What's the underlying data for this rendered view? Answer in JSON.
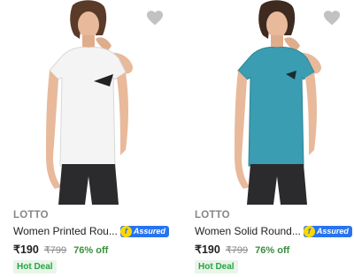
{
  "products": [
    {
      "brand": "LOTTO",
      "title": "Women Printed Rou...",
      "assured_label": "Assured",
      "assured_glyph": "f",
      "price": "₹190",
      "mrp": "₹799",
      "discount": "76% off",
      "deal_badge": "Hot Deal",
      "shirt_color": "#f4f4f4",
      "wishlist_icon": "heart-icon"
    },
    {
      "brand": "LOTTO",
      "title": "Women Solid Round...",
      "assured_label": "Assured",
      "assured_glyph": "f",
      "price": "₹190",
      "mrp": "₹799",
      "discount": "76% off",
      "deal_badge": "Hot Deal",
      "shirt_color": "#3a9db2",
      "wishlist_icon": "heart-icon"
    }
  ],
  "colors": {
    "assured_blue": "#2874f0",
    "discount_green": "#388e3c",
    "deal_green": "#26a541",
    "heart_grey": "#c2c2c2"
  }
}
